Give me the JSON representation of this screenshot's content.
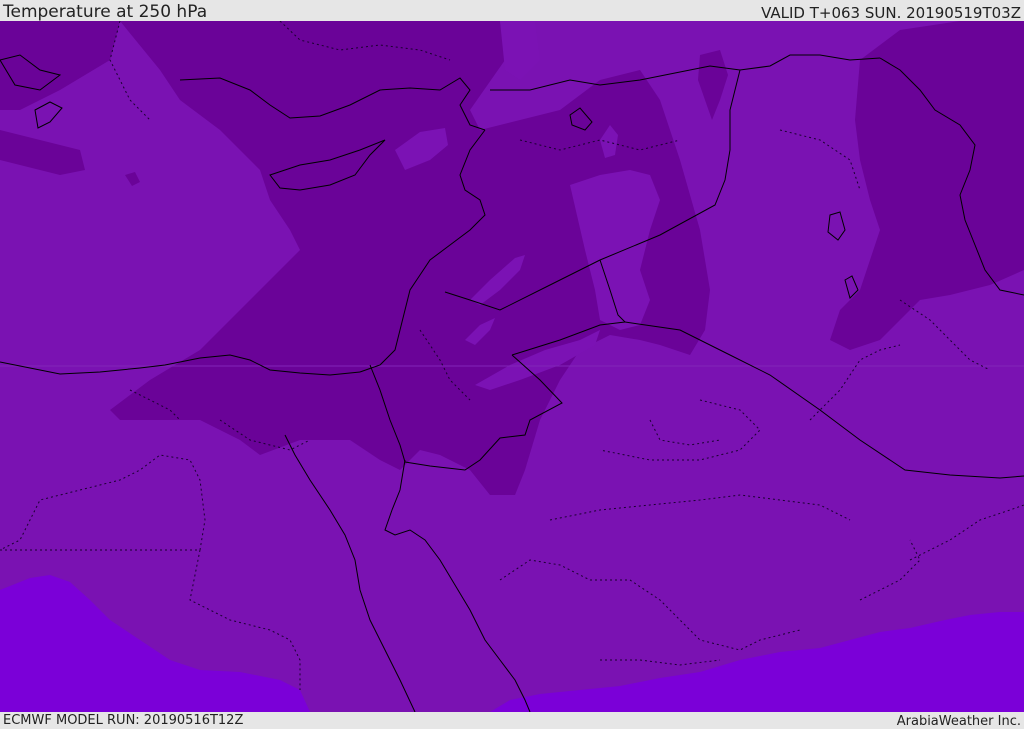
{
  "header": {
    "title": "Temperature at 250 hPa",
    "valid_time": "VALID T+063 SUN. 20190519T03Z"
  },
  "footer": {
    "model_run": "ECMWF MODEL RUN: 20190516T12Z",
    "credit": "ArabiaWeather Inc."
  },
  "map": {
    "field": "Temperature",
    "level": "250 hPa",
    "colors": {
      "coldest": "#6a0398",
      "cold": "#7b12b4",
      "mild": "#8a2ec2",
      "warmest": "#7b00d8",
      "border": "#000000"
    }
  }
}
